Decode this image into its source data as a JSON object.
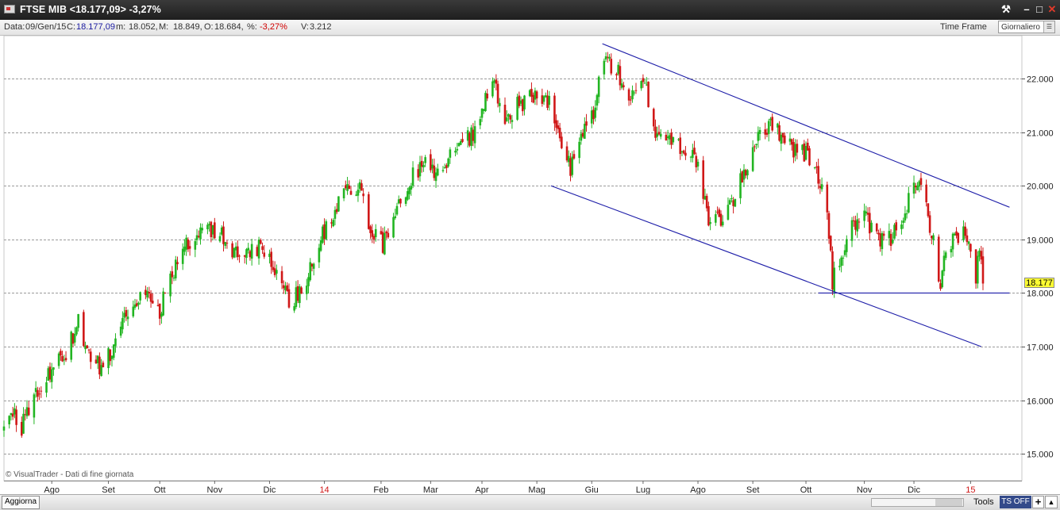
{
  "window": {
    "title": "FTSE MIB <18.177,09> -3,27%"
  },
  "infobar": {
    "data_label": "Data:",
    "data_value": "09/Gen/15",
    "close_label": "C:",
    "close_value": "18.177,09",
    "min_label": "m:",
    "min_value": "18.052,",
    "max_label": "M:",
    "max_value": "18.849,",
    "open_label": "O:",
    "open_value": "18.684,",
    "pct_label": "%:",
    "pct_value": "-3,27%",
    "vol_label": "V:",
    "vol_value": "3.212",
    "timeframe_label": "Time Frame",
    "timeframe_value": "Giornaliero"
  },
  "footer": {
    "copyright": "© VisualTrader - Dati di fine giornata",
    "refresh_label": "Aggiorna",
    "tools_label": "Tools",
    "tsoff_label": "TS OFF",
    "plus_label": "+"
  },
  "colors": {
    "up": "#22b522",
    "down": "#d01818",
    "trendline": "#1c1ca8",
    "grid": "#9a9a9a",
    "last_price_bg": "#ffff33"
  },
  "chart_data": {
    "type": "candlestick",
    "title": "FTSE MIB",
    "ylim": [
      14500,
      22800
    ],
    "y_ticks": [
      "22.000",
      "21.000",
      "20.000",
      "19.000",
      "18.000",
      "17.000",
      "16.000",
      "15.000"
    ],
    "y_tick_values": [
      22000,
      21000,
      20000,
      19000,
      18000,
      17000,
      16000,
      15000
    ],
    "x_labels": [
      {
        "label": "Ago",
        "date": "2013-08-01",
        "highlight": false
      },
      {
        "label": "Set",
        "date": "2013-09-02",
        "highlight": false
      },
      {
        "label": "Ott",
        "date": "2013-10-01",
        "highlight": false
      },
      {
        "label": "Nov",
        "date": "2013-11-01",
        "highlight": false
      },
      {
        "label": "Dic",
        "date": "2013-12-02",
        "highlight": false
      },
      {
        "label": "14",
        "date": "2014-01-02",
        "highlight": true
      },
      {
        "label": "Feb",
        "date": "2014-02-03",
        "highlight": false
      },
      {
        "label": "Mar",
        "date": "2014-03-03",
        "highlight": false
      },
      {
        "label": "Apr",
        "date": "2014-04-01",
        "highlight": false
      },
      {
        "label": "Mag",
        "date": "2014-05-02",
        "highlight": false
      },
      {
        "label": "Giu",
        "date": "2014-06-02",
        "highlight": false
      },
      {
        "label": "Lug",
        "date": "2014-07-01",
        "highlight": false
      },
      {
        "label": "Ago",
        "date": "2014-08-01",
        "highlight": false
      },
      {
        "label": "Set",
        "date": "2014-09-01",
        "highlight": false
      },
      {
        "label": "Ott",
        "date": "2014-10-01",
        "highlight": false
      },
      {
        "label": "Nov",
        "date": "2014-11-03",
        "highlight": false
      },
      {
        "label": "Dic",
        "date": "2014-12-01",
        "highlight": false
      },
      {
        "label": "15",
        "date": "2015-01-02",
        "highlight": true
      }
    ],
    "x_start": "2013-07-05",
    "x_end": "2015-01-09",
    "close_path": [
      [
        "2013-07-05",
        15600
      ],
      [
        "2013-07-10",
        15750
      ],
      [
        "2013-07-15",
        15500
      ],
      [
        "2013-07-20",
        15900
      ],
      [
        "2013-07-27",
        16300
      ],
      [
        "2013-08-03",
        16650
      ],
      [
        "2013-08-10",
        16900
      ],
      [
        "2013-08-16",
        17500
      ],
      [
        "2013-08-22",
        16850
      ],
      [
        "2013-08-28",
        16650
      ],
      [
        "2013-09-03",
        16850
      ],
      [
        "2013-09-10",
        17400
      ],
      [
        "2013-09-17",
        17800
      ],
      [
        "2013-09-25",
        18000
      ],
      [
        "2013-09-30",
        17600
      ],
      [
        "2013-10-05",
        18050
      ],
      [
        "2013-10-12",
        18650
      ],
      [
        "2013-10-22",
        19200
      ],
      [
        "2013-10-30",
        19150
      ],
      [
        "2013-11-05",
        19100
      ],
      [
        "2013-11-12",
        18800
      ],
      [
        "2013-11-20",
        18700
      ],
      [
        "2013-11-28",
        18900
      ],
      [
        "2013-12-04",
        18400
      ],
      [
        "2013-12-12",
        17900
      ],
      [
        "2013-12-18",
        17950
      ],
      [
        "2013-12-24",
        18300
      ],
      [
        "2013-12-31",
        19000
      ],
      [
        "2014-01-08",
        19600
      ],
      [
        "2014-01-15",
        20050
      ],
      [
        "2014-01-22",
        19900
      ],
      [
        "2014-01-28",
        19200
      ],
      [
        "2014-02-04",
        18900
      ],
      [
        "2014-02-11",
        19500
      ],
      [
        "2014-02-20",
        20150
      ],
      [
        "2014-02-27",
        20450
      ],
      [
        "2014-03-05",
        20200
      ],
      [
        "2014-03-14",
        20600
      ],
      [
        "2014-03-21",
        20800
      ],
      [
        "2014-03-28",
        21000
      ],
      [
        "2014-04-04",
        21700
      ],
      [
        "2014-04-08",
        21950
      ],
      [
        "2014-04-14",
        21200
      ],
      [
        "2014-04-18",
        21400
      ],
      [
        "2014-04-25",
        21600
      ],
      [
        "2014-05-02",
        21700
      ],
      [
        "2014-05-09",
        21500
      ],
      [
        "2014-05-15",
        20900
      ],
      [
        "2014-05-21",
        20300
      ],
      [
        "2014-05-27",
        20900
      ],
      [
        "2014-06-03",
        21400
      ],
      [
        "2014-06-09",
        22400
      ],
      [
        "2014-06-16",
        22150
      ],
      [
        "2014-06-24",
        21600
      ],
      [
        "2014-07-02",
        21900
      ],
      [
        "2014-07-08",
        21000
      ],
      [
        "2014-07-16",
        20900
      ],
      [
        "2014-07-24",
        20700
      ],
      [
        "2014-07-31",
        20500
      ],
      [
        "2014-08-07",
        19300
      ],
      [
        "2014-08-14",
        19400
      ],
      [
        "2014-08-22",
        19800
      ],
      [
        "2014-08-29",
        20400
      ],
      [
        "2014-09-04",
        21000
      ],
      [
        "2014-09-10",
        21100
      ],
      [
        "2014-09-17",
        21000
      ],
      [
        "2014-09-24",
        20700
      ],
      [
        "2014-10-01",
        20600
      ],
      [
        "2014-10-08",
        20200
      ],
      [
        "2014-10-13",
        19500
      ],
      [
        "2014-10-16",
        18200
      ],
      [
        "2014-10-21",
        18700
      ],
      [
        "2014-10-28",
        19300
      ],
      [
        "2014-11-03",
        19400
      ],
      [
        "2014-11-10",
        19000
      ],
      [
        "2014-11-18",
        19000
      ],
      [
        "2014-11-25",
        19500
      ],
      [
        "2014-12-01",
        19900
      ],
      [
        "2014-12-05",
        20000
      ],
      [
        "2014-12-10",
        19300
      ],
      [
        "2014-12-16",
        18200
      ],
      [
        "2014-12-19",
        18700
      ],
      [
        "2014-12-24",
        19100
      ],
      [
        "2014-12-30",
        19100
      ],
      [
        "2015-01-05",
        18300
      ],
      [
        "2015-01-07",
        18800
      ],
      [
        "2015-01-09",
        18177
      ]
    ],
    "trendlines": [
      {
        "name": "channel-upper",
        "from": [
          "2014-06-08",
          22650
        ],
        "to": [
          "2015-01-24",
          19600
        ]
      },
      {
        "name": "channel-lower",
        "from": [
          "2014-05-10",
          20000
        ],
        "to": [
          "2015-01-08",
          17000
        ]
      },
      {
        "name": "support",
        "from": [
          "2014-10-08",
          18000
        ],
        "to": [
          "2015-01-24",
          18000
        ]
      }
    ],
    "last_price": 18177.09,
    "last_price_label": "18.177",
    "grid": true
  }
}
